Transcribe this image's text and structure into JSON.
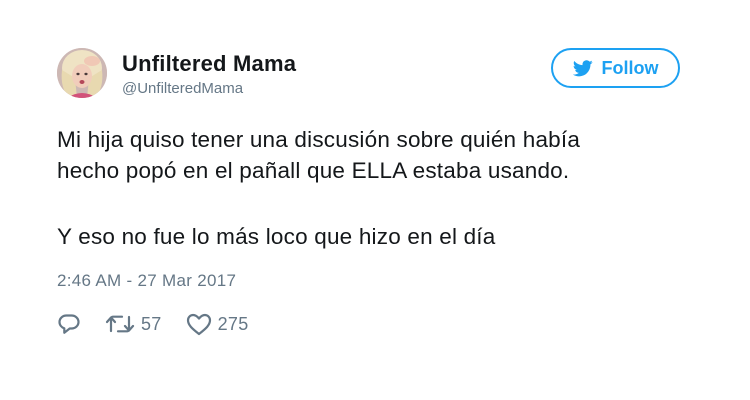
{
  "tweet": {
    "author": {
      "display_name": "Unfiltered Mama",
      "handle": "@UnfilteredMama",
      "avatar_icon": "profile-photo"
    },
    "follow_button": {
      "label": "Follow",
      "icon": "bird-icon",
      "color": "#1da1f2"
    },
    "text_lines": [
      "Mi hija quiso tener una discusión sobre quién había",
      "hecho popó en el pañall que ELLA estaba usando.",
      "Y eso no fue lo más loco que hizo en el día"
    ],
    "timestamp": "2:46 AM - 27 Mar 2017",
    "actions": {
      "reply_icon": "reply-icon",
      "retweet_icon": "retweet-icon",
      "retweet_count": "57",
      "like_icon": "heart-icon",
      "like_count": "275"
    },
    "colors": {
      "text": "#14171a",
      "secondary": "#657786",
      "accent": "#1da1f2"
    }
  }
}
